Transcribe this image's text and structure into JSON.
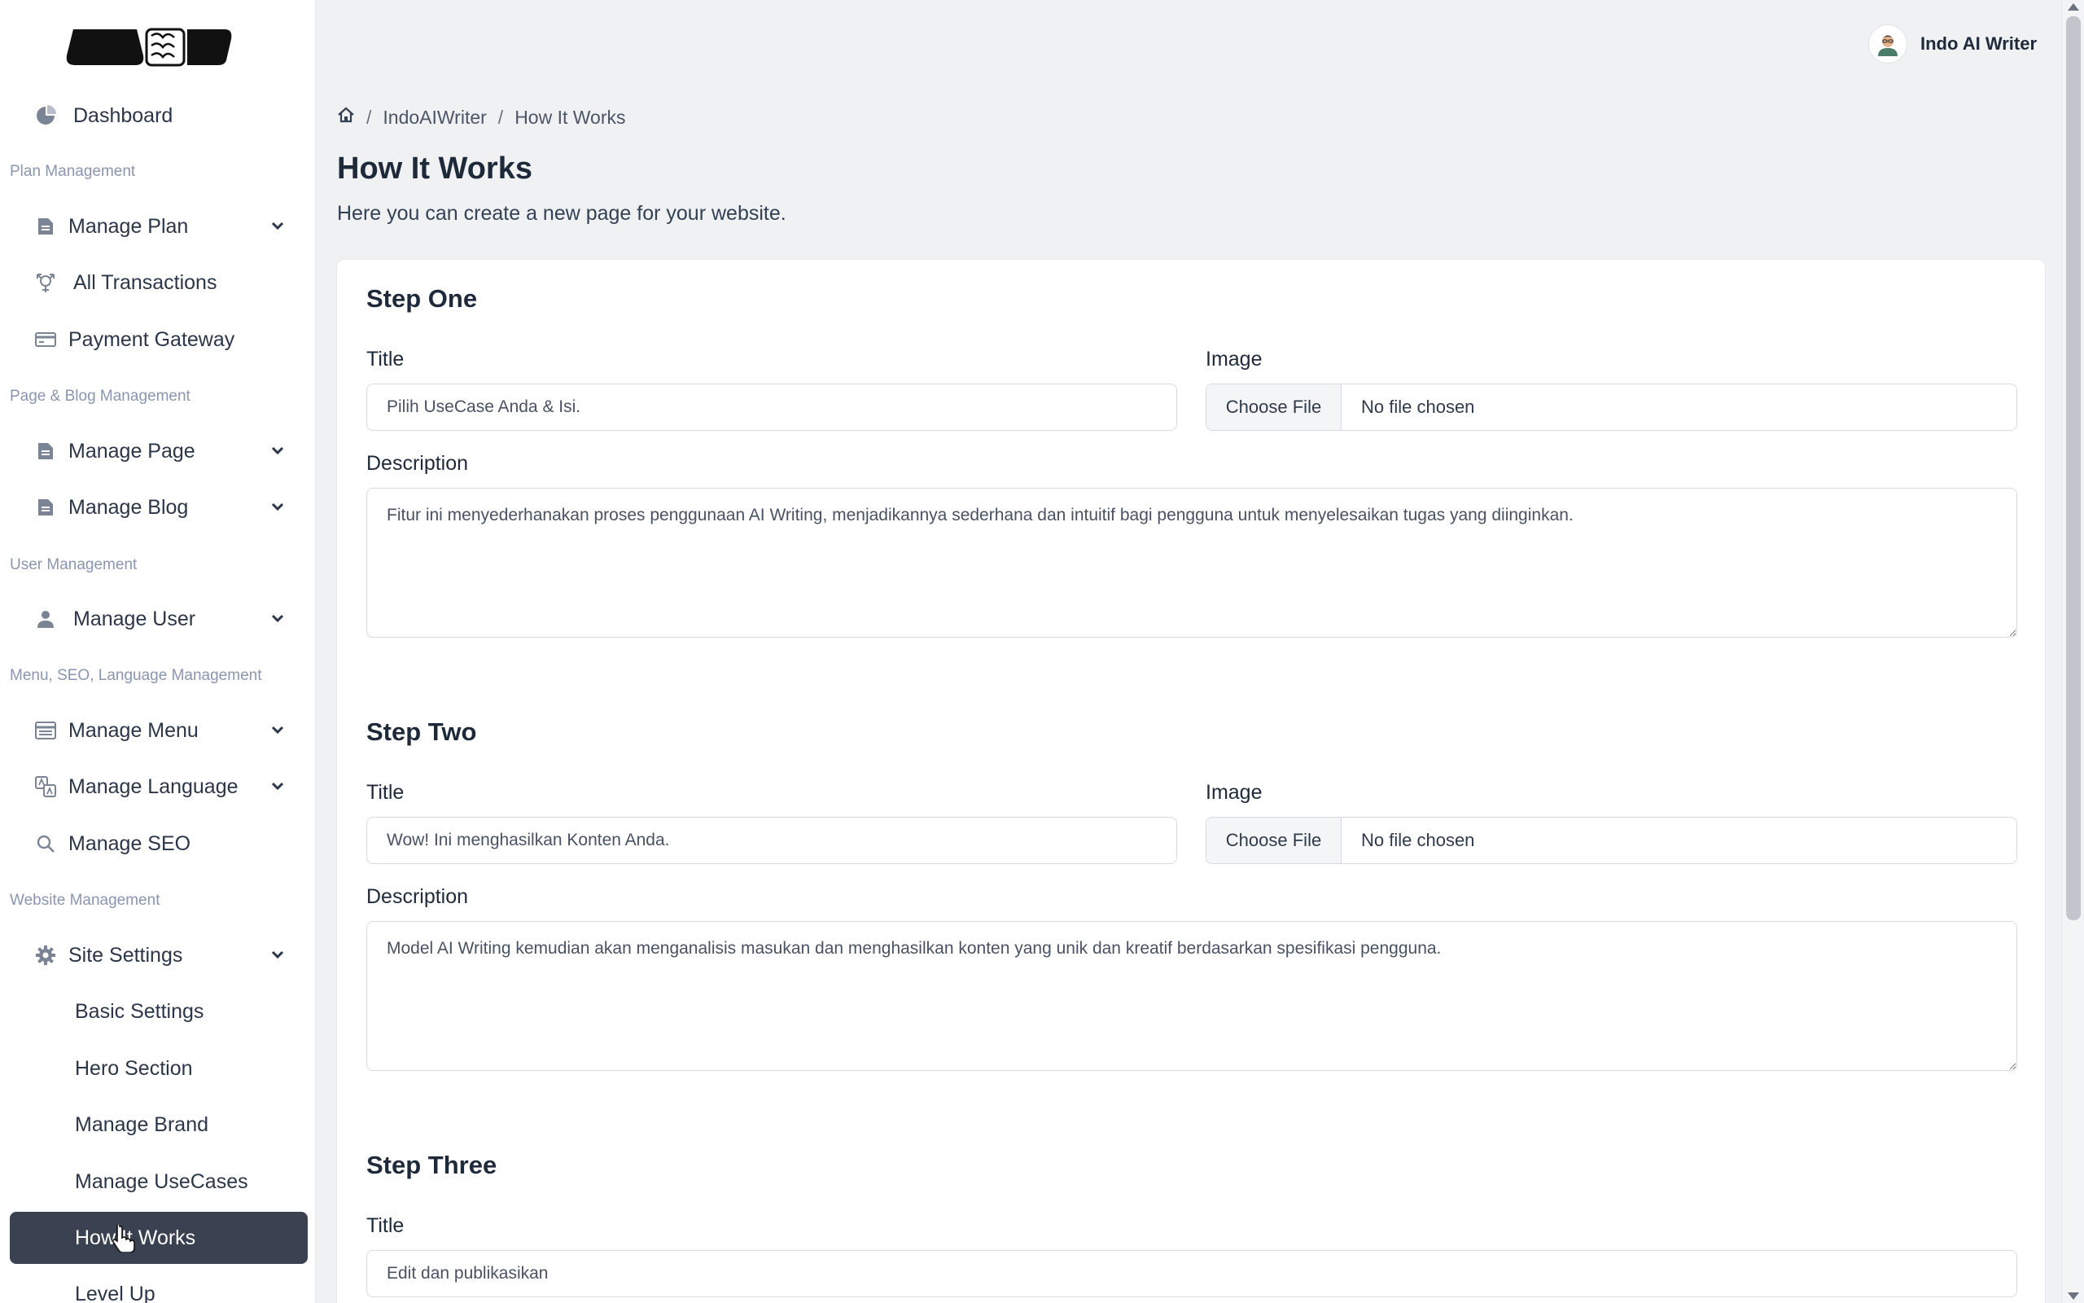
{
  "sidebar": {
    "top_items": [
      {
        "label": "Dashboard",
        "icon": "pie-chart-icon"
      }
    ],
    "sections": [
      {
        "label": "Plan Management"
      },
      {
        "label": "Page & Blog Management"
      },
      {
        "label": "User Management"
      },
      {
        "label": "Menu, SEO, Language Management"
      },
      {
        "label": "Website Management"
      }
    ],
    "items": {
      "manage_plan": "Manage Plan",
      "all_transactions": "All Transactions",
      "payment_gateway": "Payment Gateway",
      "manage_page": "Manage Page",
      "manage_blog": "Manage Blog",
      "manage_user": "Manage User",
      "manage_menu": "Manage Menu",
      "manage_language": "Manage Language",
      "manage_seo": "Manage SEO",
      "site_settings": "Site Settings",
      "basic_settings": "Basic Settings",
      "hero_section": "Hero Section",
      "manage_brand": "Manage Brand",
      "manage_usecases": "Manage UseCases",
      "how_it_works": "How It Works",
      "level_up": "Level Up"
    }
  },
  "header": {
    "user_name": "Indo AI Writer"
  },
  "breadcrumb": [
    "IndoAIWriter",
    "How It Works"
  ],
  "page": {
    "title": "How It Works",
    "subtitle": "Here you can create a new page for your website."
  },
  "form": {
    "labels": {
      "title": "Title",
      "image": "Image",
      "description": "Description",
      "choose_file": "Choose File",
      "no_file": "No file chosen"
    },
    "steps": [
      {
        "heading": "Step One",
        "title_value": "Pilih UseCase Anda & Isi.",
        "description_value": "Fitur ini menyederhanakan proses penggunaan AI Writing, menjadikannya sederhana dan intuitif bagi pengguna untuk menyelesaikan tugas yang diinginkan."
      },
      {
        "heading": "Step Two",
        "title_value": "Wow! Ini menghasilkan Konten Anda.",
        "description_value": "Model AI Writing kemudian akan menganalisis masukan dan menghasilkan konten yang unik dan kreatif berdasarkan spesifikasi pengguna."
      },
      {
        "heading": "Step Three",
        "title_value": "Edit dan publikasikan"
      }
    ]
  },
  "colors": {
    "active_nav_bg": "#3a4150",
    "section_label": "#8a96b0",
    "page_bg": "#f0f1f3"
  }
}
